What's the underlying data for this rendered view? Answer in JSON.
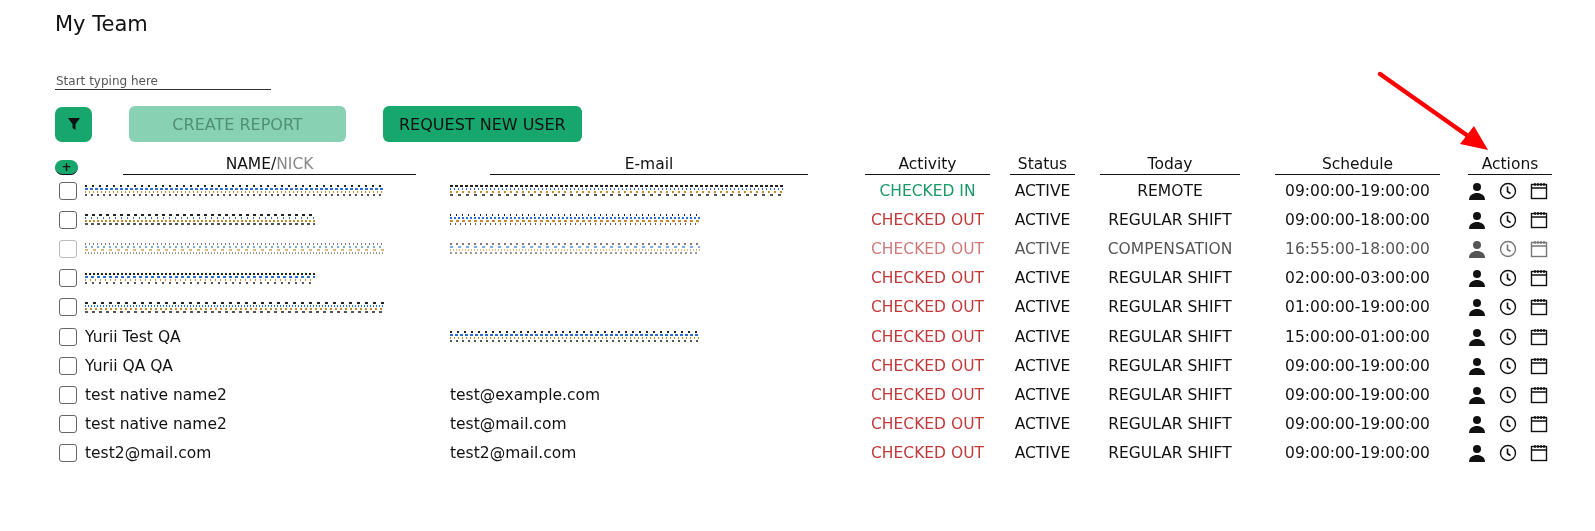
{
  "title": "My Team",
  "search": {
    "placeholder": "Start typing here"
  },
  "toolbar": {
    "filter_button": true,
    "buttons": [
      {
        "label": "CREATE REPORT",
        "disabled": true
      },
      {
        "label": "REQUEST NEW USER",
        "disabled": false
      }
    ]
  },
  "table": {
    "add_button": "+",
    "columns": [
      {
        "label": "NAME/",
        "sublabel": "NICK"
      },
      {
        "label": "E-mail"
      },
      {
        "label": "Activity"
      },
      {
        "label": "Status"
      },
      {
        "label": "Today"
      },
      {
        "label": "Schedule"
      },
      {
        "label": "Actions"
      }
    ],
    "rows": [
      {
        "checked": false,
        "disabled": false,
        "name": {
          "redacted": true
        },
        "email": {
          "redacted": true
        },
        "activity": "CHECKED IN",
        "color": "#1a9a66",
        "status": "ACTIVE",
        "today": "REMOTE",
        "schedule": "09:00:00-19:00:00"
      },
      {
        "checked": false,
        "disabled": false,
        "name": {
          "redacted": true
        },
        "email": {
          "redacted": true
        },
        "activity": "CHECKED OUT",
        "color": "#c2393a",
        "status": "ACTIVE",
        "today": "REGULAR SHIFT",
        "schedule": "09:00:00-18:00:00"
      },
      {
        "checked": false,
        "disabled": true,
        "name": {
          "redacted": true
        },
        "email": {
          "redacted": true
        },
        "activity": "CHECKED OUT",
        "color": "#d07a7a",
        "status": "ACTIVE",
        "today": "COMPENSATION",
        "schedule": "16:55:00-18:00:00"
      },
      {
        "checked": false,
        "disabled": false,
        "name": {
          "redacted": true
        },
        "activity": "CHECKED OUT",
        "color": "#c2393a",
        "status": "ACTIVE",
        "today": "REGULAR SHIFT",
        "schedule": "02:00:00-03:00:00"
      },
      {
        "checked": false,
        "disabled": false,
        "name": {
          "redacted": true
        },
        "activity": "CHECKED OUT",
        "color": "#c2393a",
        "status": "ACTIVE",
        "today": "REGULAR SHIFT",
        "schedule": "01:00:00-19:00:00"
      },
      {
        "checked": false,
        "disabled": false,
        "name": {
          "text": "Yurii Test QA"
        },
        "email": {
          "redacted": true
        },
        "activity": "CHECKED OUT",
        "color": "#c2393a",
        "status": "ACTIVE",
        "today": "REGULAR SHIFT",
        "schedule": "15:00:00-01:00:00"
      },
      {
        "checked": false,
        "disabled": false,
        "name": {
          "text": "Yurii QA QA"
        },
        "activity": "CHECKED OUT",
        "color": "#c2393a",
        "status": "ACTIVE",
        "today": "REGULAR SHIFT",
        "schedule": "09:00:00-19:00:00"
      },
      {
        "checked": false,
        "disabled": false,
        "name": {
          "text": "test native name2"
        },
        "email": {
          "text": "test@example.com"
        },
        "activity": "CHECKED OUT",
        "color": "#c2393a",
        "status": "ACTIVE",
        "today": "REGULAR SHIFT",
        "schedule": "09:00:00-19:00:00"
      },
      {
        "checked": false,
        "disabled": false,
        "name": {
          "text": "test native name2"
        },
        "email": {
          "text": "test@mail.com"
        },
        "activity": "CHECKED OUT",
        "color": "#c2393a",
        "status": "ACTIVE",
        "today": "REGULAR SHIFT",
        "schedule": "09:00:00-19:00:00"
      },
      {
        "checked": false,
        "disabled": false,
        "name": {
          "text": "test2@mail.com"
        },
        "email": {
          "text": "test2@mail.com"
        },
        "activity": "CHECKED OUT",
        "color": "#c2393a",
        "status": "ACTIVE",
        "today": "REGULAR SHIFT",
        "schedule": "09:00:00-19:00:00"
      }
    ]
  },
  "annotation": {
    "kind": "arrow",
    "color": "#ff0000"
  }
}
